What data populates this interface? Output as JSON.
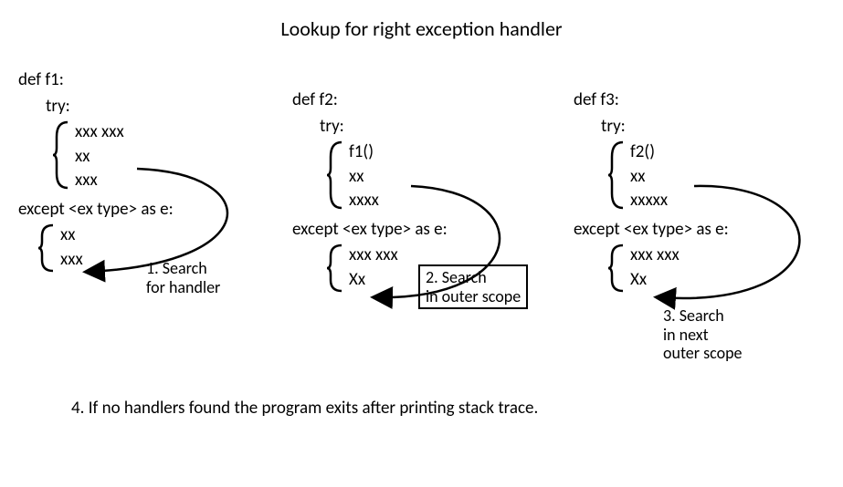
{
  "title": "Lookup for right exception handler",
  "f1": {
    "def": "def f1:",
    "try": "try:",
    "try_body": [
      "xxx xxx",
      "xx",
      "xxx"
    ],
    "except": "except <ex type> as e:",
    "except_body": [
      "xx",
      "xxx"
    ]
  },
  "f2": {
    "def": "def f2:",
    "try": "try:",
    "try_body": [
      "f1()",
      "xx",
      "xxxx"
    ],
    "except": "except <ex type> as e:",
    "except_body": [
      "xxx xxx",
      "Xx"
    ]
  },
  "f3": {
    "def": "def f3:",
    "try": "try:",
    "try_body": [
      "f2()",
      "xx",
      "xxxxx"
    ],
    "except": "except <ex type> as e:",
    "except_body": [
      "xxx xxx",
      "Xx"
    ]
  },
  "steps": {
    "s1a": "1. Search",
    "s1b": "for handler",
    "s2a": "2. Search",
    "s2b": "in outer scope",
    "s3a": "3. Search",
    "s3b": "in next",
    "s3c": "outer scope"
  },
  "footer": "4. If no handlers found the program exits after printing stack trace."
}
